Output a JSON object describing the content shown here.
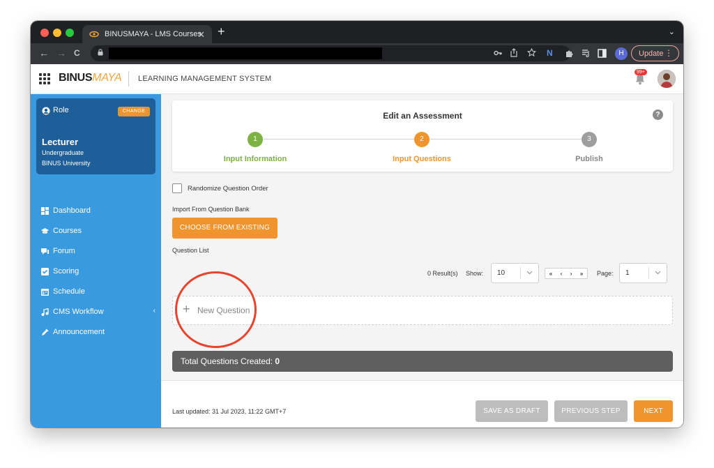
{
  "browser": {
    "tab_title": "BINUSMAYA - LMS Courses",
    "tab_close": "✕",
    "new_tab": "+",
    "tab_menu": "⌄",
    "nav_back": "←",
    "nav_forward": "→",
    "nav_reload": "C",
    "update_label": "Update",
    "update_menu": "⋮",
    "profile_initial": "H"
  },
  "app": {
    "logo_binus": "BINUS",
    "logo_maya": "MAYA",
    "system_title": "LEARNING MANAGEMENT SYSTEM",
    "notification_count": "99+"
  },
  "sidebar": {
    "role_label": "Role",
    "change_label": "CHANGE",
    "role_name": "Lecturer",
    "role_level": "Undergraduate",
    "role_org": "BINUS University",
    "items": [
      {
        "label": "Dashboard",
        "icon": "dashboard-icon"
      },
      {
        "label": "Courses",
        "icon": "courses-icon"
      },
      {
        "label": "Forum",
        "icon": "forum-icon"
      },
      {
        "label": "Scoring",
        "icon": "scoring-icon"
      },
      {
        "label": "Schedule",
        "icon": "schedule-icon"
      },
      {
        "label": "CMS Workflow",
        "icon": "cms-workflow-icon",
        "expand": "‹"
      },
      {
        "label": "Announcement",
        "icon": "announcement-icon"
      }
    ]
  },
  "stepper": {
    "title": "Edit an Assessment",
    "help": "?",
    "steps": [
      {
        "number": "1",
        "label": "Input Information",
        "color": "#7cb342"
      },
      {
        "number": "2",
        "label": "Input Questions",
        "color": "#f0952e"
      },
      {
        "number": "3",
        "label": "Publish",
        "color": "#9e9e9e"
      }
    ]
  },
  "main": {
    "randomize_label": "Randomize Question Order",
    "randomize_checked": false,
    "import_label": "Import From Question Bank",
    "choose_button": "CHOOSE FROM EXISTING",
    "question_list_label": "Question List",
    "result_count": "0 Result(s)",
    "show_label": "Show:",
    "show_value": "10",
    "pager_first": "«",
    "pager_prev": "‹",
    "pager_next": "›",
    "pager_last": "»",
    "page_label": "Page:",
    "page_value": "1",
    "new_question_plus": "+",
    "new_question_label": "New Question",
    "total_label": "Total Questions Created:",
    "total_value": "0"
  },
  "footer": {
    "last_updated": "Last updated: 31 Jul 2023, 11:22 GMT+7",
    "save_draft": "SAVE AS DRAFT",
    "previous_step": "PREVIOUS STEP",
    "next": "NEXT"
  },
  "colors": {
    "accent_orange": "#f0952e",
    "sidebar_blue": "#3a9ae0",
    "role_card_blue": "#1f5f99",
    "annotation_red": "#e8432f"
  }
}
